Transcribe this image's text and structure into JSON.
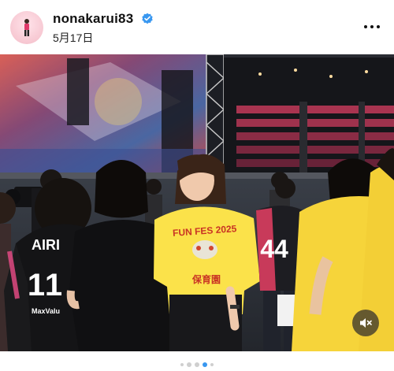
{
  "post": {
    "username": "nonakarui83",
    "date": "5月17日",
    "verified": true,
    "accent_color": "#3897f0"
  },
  "icons": {
    "more": "more-options-icon",
    "verified": "verified-badge-icon",
    "mute": "speaker-muted-icon"
  },
  "media": {
    "shirt_print_top": "FUN FES 2025",
    "shirt_print_bottom": "保育園",
    "jersey_name": "AIRI",
    "jersey_number": "11",
    "jersey_sponsor": "MaxValu",
    "red_jersey_number": "44",
    "muted": true
  },
  "carousel": {
    "total": 5,
    "active_index": 3
  }
}
